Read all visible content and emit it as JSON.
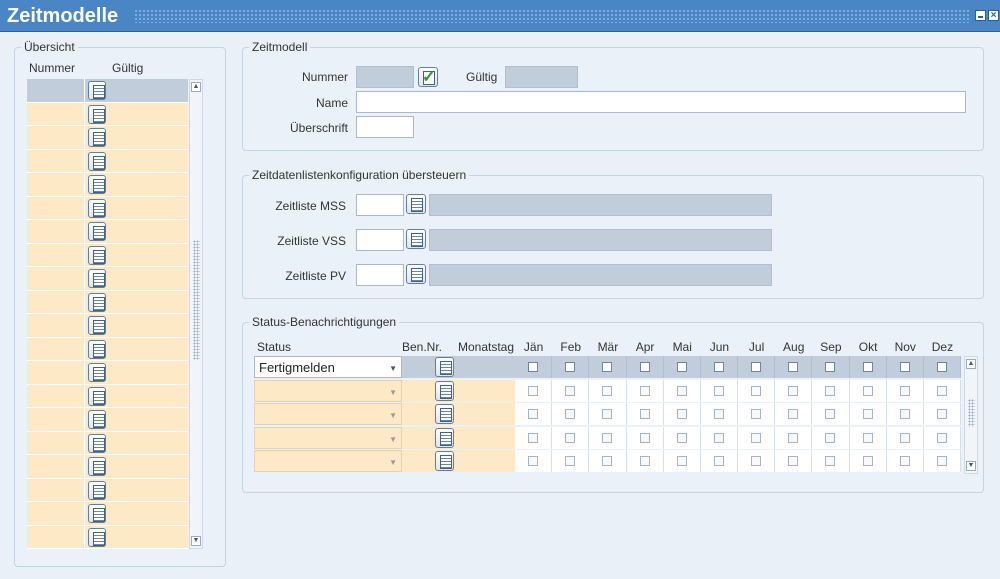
{
  "window": {
    "title": "Zeitmodelle"
  },
  "overview": {
    "legend": "Übersicht",
    "col_nummer": "Nummer",
    "col_gueltig": "Gültig",
    "row_count": 20
  },
  "zeitmodell": {
    "legend": "Zeitmodell",
    "nummer_label": "Nummer",
    "gueltig_label": "Gültig",
    "name_label": "Name",
    "ueberschrift_label": "Überschrift",
    "nummer_value": "",
    "gueltig_value": "",
    "name_value": "",
    "ueberschrift_value": ""
  },
  "zeitdaten": {
    "legend": "Zeitdatenlistenkonfiguration übersteuern",
    "mss_label": "Zeitliste MSS",
    "vss_label": "Zeitliste VSS",
    "pv_label": "Zeitliste PV"
  },
  "status": {
    "legend": "Status-Benachrichtigungen",
    "col_status": "Status",
    "col_ben": "Ben.Nr.",
    "col_monatstag": "Monatstag",
    "months": [
      "Jän",
      "Feb",
      "Mär",
      "Apr",
      "Mai",
      "Jun",
      "Jul",
      "Aug",
      "Sep",
      "Okt",
      "Nov",
      "Dez"
    ],
    "rows": [
      {
        "status": "Fertigmelden"
      },
      {
        "status": ""
      },
      {
        "status": ""
      },
      {
        "status": ""
      },
      {
        "status": ""
      }
    ]
  }
}
